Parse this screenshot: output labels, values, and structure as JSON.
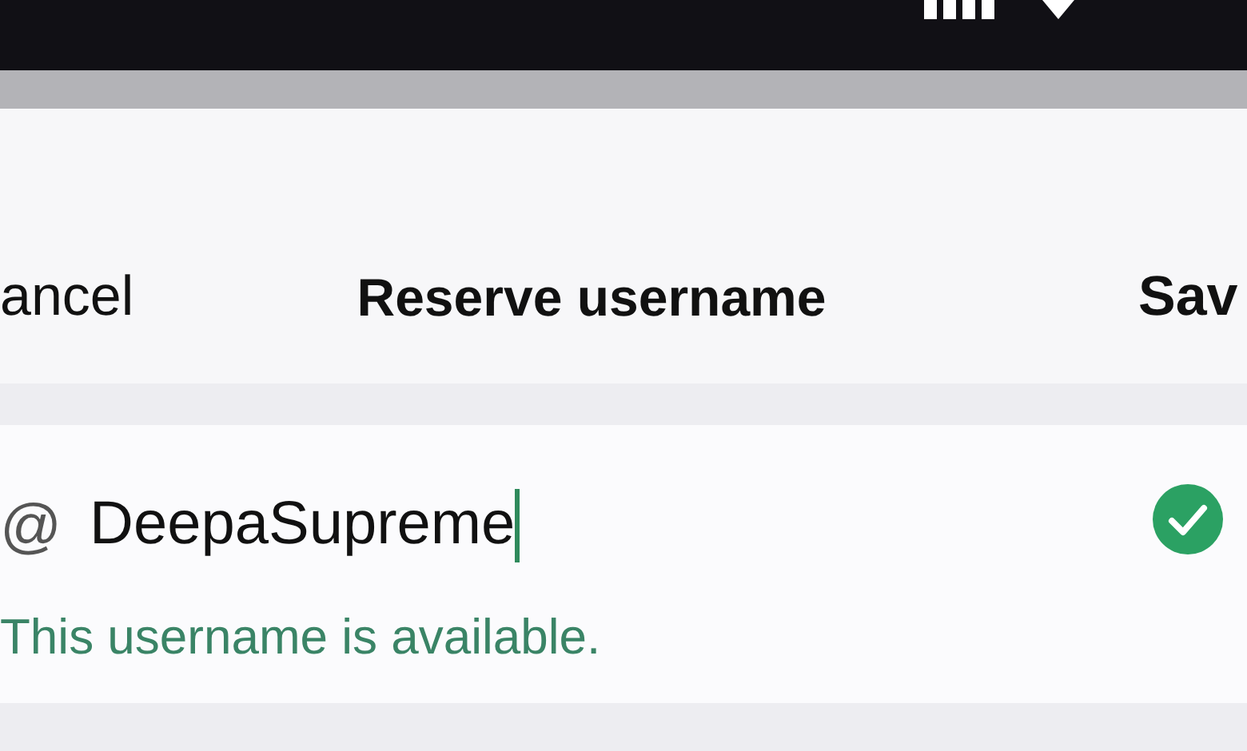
{
  "nav_bar": {
    "cancel": "ancel",
    "title": "Reserve username",
    "save": "Sav"
  },
  "username_field": {
    "prefix": "@",
    "value": "DeepaSupreme",
    "focused": true,
    "available": true
  },
  "message": "This username is available."
}
